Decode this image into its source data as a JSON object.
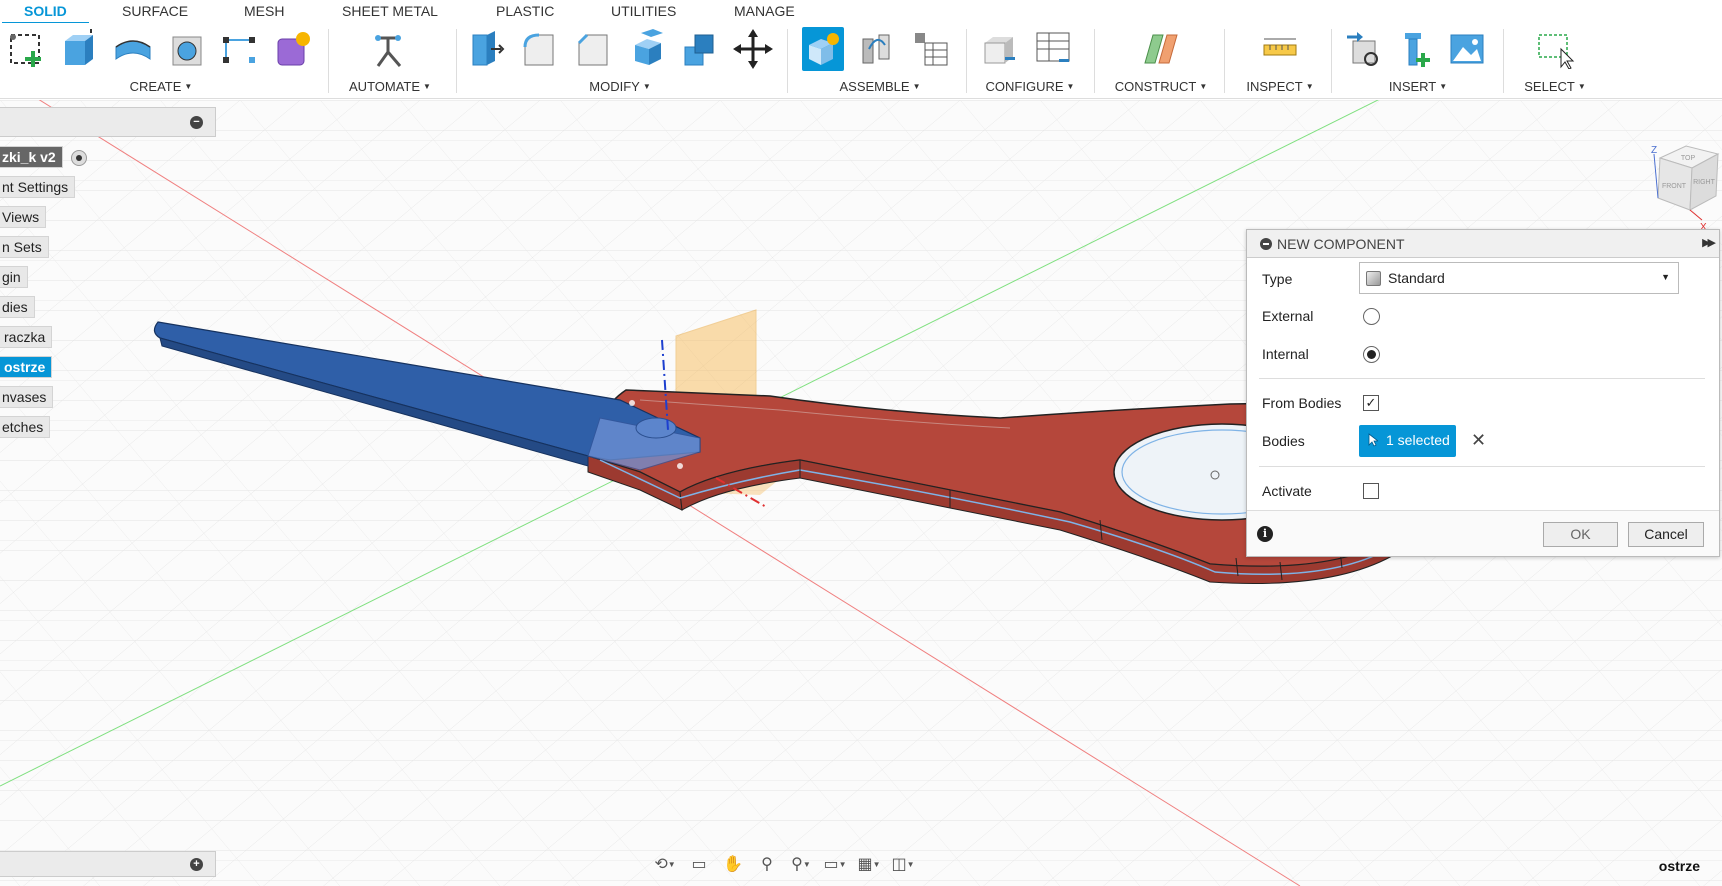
{
  "tabs": [
    {
      "label": "SOLID",
      "active": true
    },
    {
      "label": "SURFACE"
    },
    {
      "label": "MESH"
    },
    {
      "label": "SHEET METAL"
    },
    {
      "label": "PLASTIC"
    },
    {
      "label": "UTILITIES"
    },
    {
      "label": "MANAGE"
    }
  ],
  "toolbar": {
    "create": "CREATE",
    "automate": "AUTOMATE",
    "modify": "MODIFY",
    "assemble": "ASSEMBLE",
    "configure": "CONFIGURE",
    "construct": "CONSTRUCT",
    "inspect": "INSPECT",
    "insert": "INSERT",
    "select": "SELECT"
  },
  "browser": {
    "items": [
      "zki_k v2",
      "nt Settings",
      "Views",
      "n Sets",
      "gin",
      "dies",
      "raczka",
      "ostrze",
      "nvases",
      "etches"
    ]
  },
  "viewcube": {
    "top": "TOP",
    "front": "FRONT",
    "right": "RIGHT",
    "z": "Z",
    "x": "X"
  },
  "dialog": {
    "title": "NEW COMPONENT",
    "type_label": "Type",
    "type_value": "Standard",
    "external_label": "External",
    "internal_label": "Internal",
    "from_bodies_label": "From Bodies",
    "bodies_label": "Bodies",
    "bodies_value": "1 selected",
    "activate_label": "Activate",
    "ok": "OK",
    "cancel": "Cancel",
    "info": "i"
  },
  "status": {
    "active_component": "ostrze"
  },
  "colors": {
    "accent": "#0696d7",
    "blade": "#2f5fa8",
    "handle": "#b5473b",
    "plane": "#f7b54a"
  }
}
